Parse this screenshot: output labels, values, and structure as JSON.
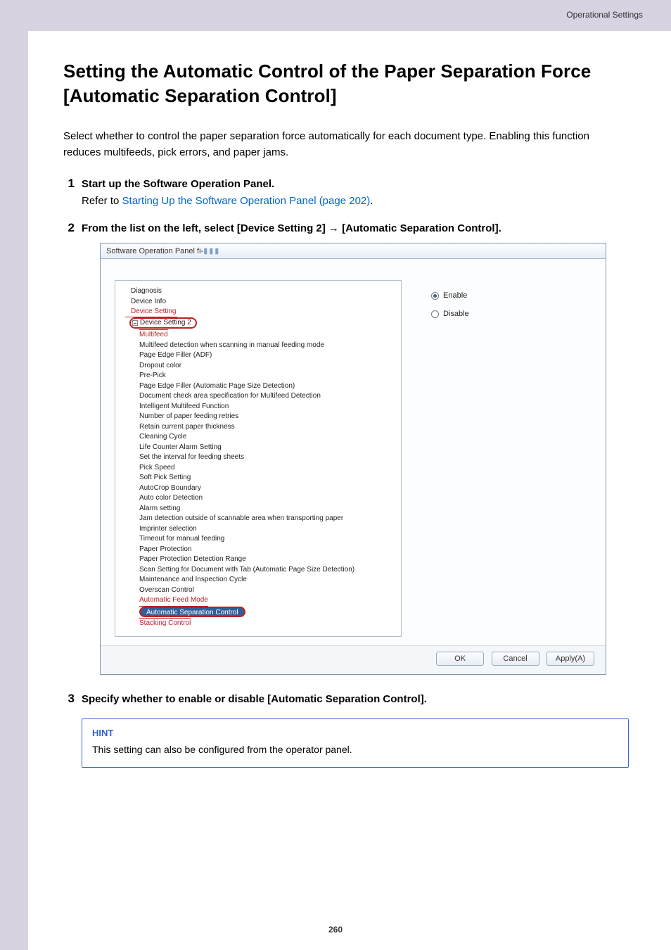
{
  "header": {
    "section": "Operational Settings"
  },
  "title": "Setting the Automatic Control of the Paper Separation Force [Automatic Separation Control]",
  "intro": "Select whether to control the paper separation force automatically for each document type. Enabling this function reduces multifeeds, pick errors, and paper jams.",
  "steps": [
    {
      "num": "1",
      "title": "Start up the Software Operation Panel.",
      "sub_prefix": "Refer to ",
      "link": "Starting Up the Software Operation Panel (page 202)",
      "sub_suffix": "."
    },
    {
      "num": "2",
      "title": "From the list on the left, select [Device Setting 2] → [Automatic Separation Control]."
    },
    {
      "num": "3",
      "title": "Specify whether to enable or disable [Automatic Separation Control]."
    }
  ],
  "dialog": {
    "window_title_prefix": "Software Operation Panel fi-",
    "tree_top": [
      "Diagnosis",
      "Device Info",
      "Device Setting"
    ],
    "ds2_label": "Device Setting 2",
    "ds2_first_red": "Multifeed",
    "tree_items": [
      "Multifeed detection when scanning in manual feeding mode",
      "Page Edge Filler (ADF)",
      "Dropout color",
      "Pre-Pick",
      "Page Edge Filler (Automatic Page Size Detection)",
      "Document check area specification for Multifeed Detection",
      "Intelligent Multifeed Function",
      "Number of paper feeding retries",
      "Retain current paper thickness",
      "Cleaning Cycle",
      "Life Counter Alarm Setting",
      "Set the interval for feeding sheets",
      "Pick Speed",
      "Soft Pick Setting",
      "AutoCrop Boundary",
      "Auto color Detection",
      "Alarm setting",
      "Jam detection outside of scannable area when transporting paper",
      "Imprinter selection",
      "Timeout for manual feeding",
      "Paper Protection",
      "Paper Protection Detection Range",
      "Scan Setting for Document with Tab (Automatic Page Size Detection)",
      "Maintenance and Inspection Cycle",
      "Overscan Control",
      "Automatic Feed Mode"
    ],
    "asc_label": "Automatic Separation Control",
    "tail_red": "Stacking Control",
    "radio_enable": "Enable",
    "radio_disable": "Disable",
    "btn_ok": "OK",
    "btn_cancel": "Cancel",
    "btn_apply": "Apply(A)"
  },
  "hint": {
    "label": "HINT",
    "text": "This setting can also be configured from the operator panel."
  },
  "page_number": "260"
}
